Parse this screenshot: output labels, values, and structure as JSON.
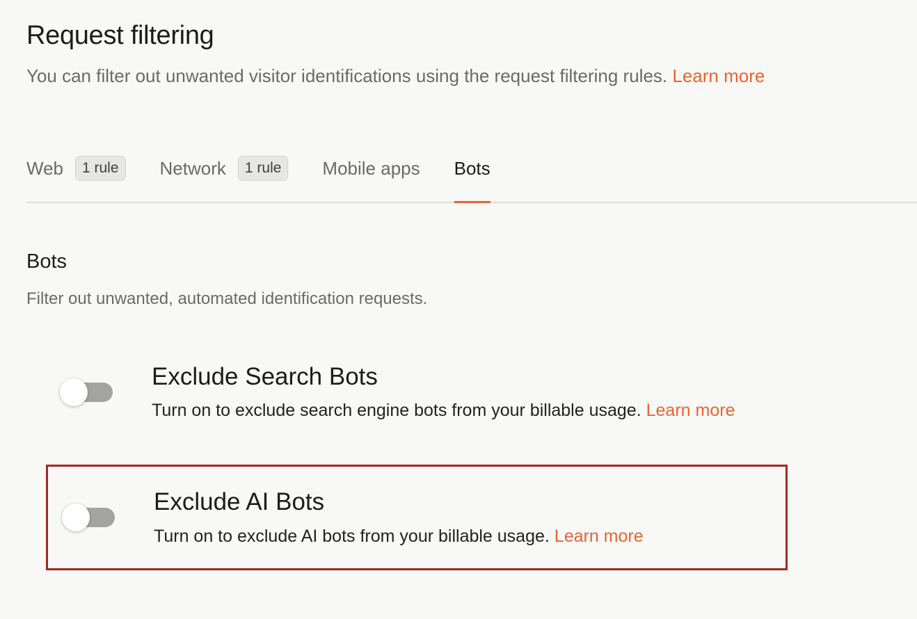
{
  "header": {
    "title": "Request filtering",
    "subtitle": "You can filter out unwanted visitor identifications using the request filtering rules.",
    "learn_more": "Learn more"
  },
  "tabs": [
    {
      "label": "Web",
      "badge": "1 rule",
      "active": false
    },
    {
      "label": "Network",
      "badge": "1 rule",
      "active": false
    },
    {
      "label": "Mobile apps",
      "active": false
    },
    {
      "label": "Bots",
      "active": true
    }
  ],
  "bots_section": {
    "title": "Bots",
    "description": "Filter out unwanted, automated identification requests.",
    "settings": [
      {
        "title": "Exclude Search Bots",
        "description": "Turn on to exclude search engine bots from your billable usage.",
        "learn_more": "Learn more",
        "enabled": false
      },
      {
        "title": "Exclude AI Bots",
        "description": "Turn on to exclude AI bots from your billable usage.",
        "learn_more": "Learn more",
        "enabled": false,
        "highlighted": true
      }
    ]
  },
  "colors": {
    "accent": "#e8642f",
    "highlight_border": "#a22a1c",
    "toggle_off": "#a3a3a1",
    "background": "#f8f8f6"
  }
}
